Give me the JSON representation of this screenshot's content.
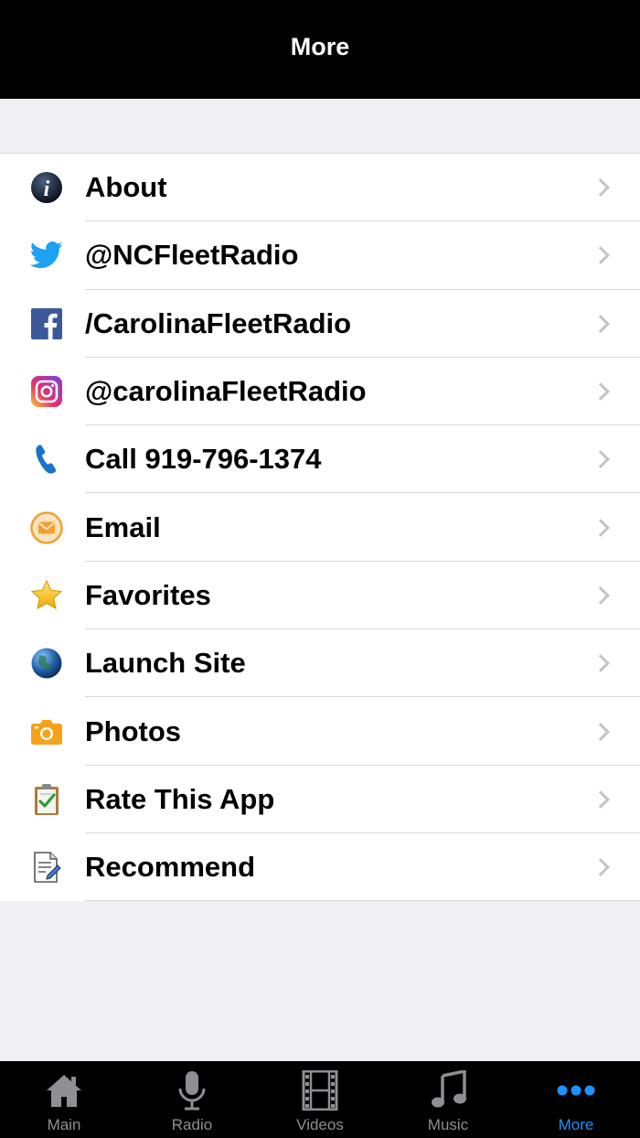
{
  "header": {
    "title": "More"
  },
  "menu": {
    "items": [
      {
        "label": "About",
        "icon": "info-icon"
      },
      {
        "label": "@NCFleetRadio",
        "icon": "twitter-icon"
      },
      {
        "label": "/CarolinaFleetRadio",
        "icon": "facebook-icon"
      },
      {
        "label": "@carolinaFleetRadio",
        "icon": "instagram-icon"
      },
      {
        "label": "Call 919-796-1374",
        "icon": "phone-icon"
      },
      {
        "label": "Email",
        "icon": "email-icon"
      },
      {
        "label": "Favorites",
        "icon": "star-icon"
      },
      {
        "label": "Launch Site",
        "icon": "globe-icon"
      },
      {
        "label": "Photos",
        "icon": "camera-icon"
      },
      {
        "label": "Rate This App",
        "icon": "clipboard-check-icon"
      },
      {
        "label": "Recommend",
        "icon": "document-edit-icon"
      }
    ]
  },
  "tabbar": {
    "tabs": [
      {
        "label": "Main",
        "icon": "home-icon",
        "active": false
      },
      {
        "label": "Radio",
        "icon": "microphone-icon",
        "active": false
      },
      {
        "label": "Videos",
        "icon": "film-icon",
        "active": false
      },
      {
        "label": "Music",
        "icon": "music-note-icon",
        "active": false
      },
      {
        "label": "More",
        "icon": "more-dots-icon",
        "active": true
      }
    ]
  },
  "colors": {
    "accent": "#1e90ff",
    "navbar": "#000000",
    "background": "#efeff4"
  }
}
